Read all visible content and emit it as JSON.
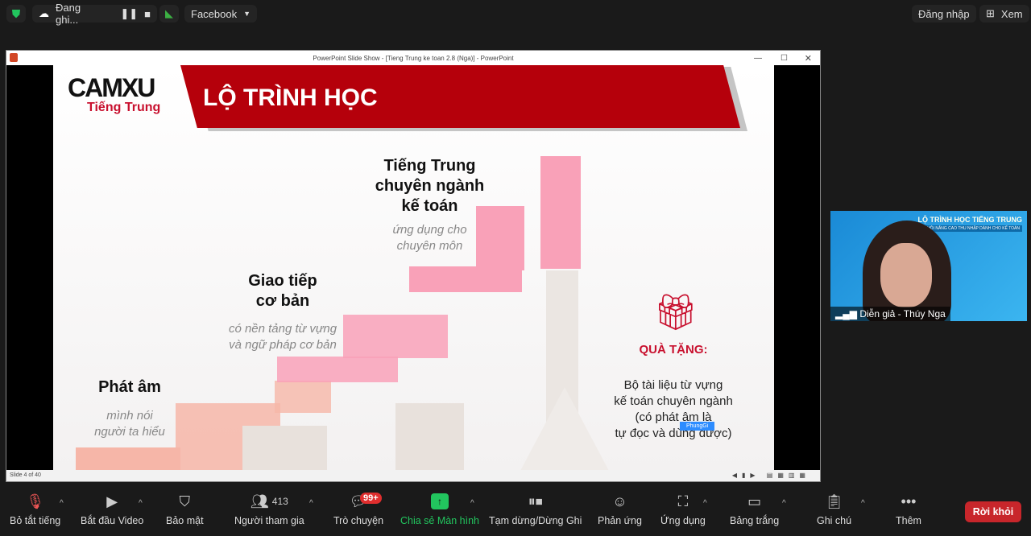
{
  "topbar": {
    "recording": "Đang ghi...",
    "stream": "Facebook",
    "login": "Đăng nhập",
    "view": "Xem"
  },
  "window": {
    "title": "PowerPoint Slide Show - [Tieng Trung ke toan 2.8 (Nga)] - PowerPoint",
    "status": "Slide 4 of 40"
  },
  "slide": {
    "logo_top": "CAMXU",
    "logo_bottom": "Tiếng Trung",
    "title": "LỘ TRÌNH HỌC",
    "steps": [
      {
        "title": "Phát âm",
        "desc": "mình nói\nngười ta hiểu"
      },
      {
        "title": "Giao tiếp\ncơ bản",
        "desc": "có nền tảng từ vựng\nvà ngữ pháp cơ bản"
      },
      {
        "title": "Tiếng Trung\nchuyên ngành\nkế toán",
        "desc": "ứng dụng cho\nchuyên môn"
      }
    ],
    "gift_title": "QUÀ TẶNG:",
    "gift_desc": "Bộ tài liệu từ vựng\nkế toán chuyên ngành\n(có phát âm là\ntự đọc và dùng được)",
    "cursor_label": "PhungGi"
  },
  "video": {
    "name": "Diễn giả - Thúy Nga",
    "banner": "LỘ TRÌNH HỌC TIẾNG TRUNG",
    "banner_sub": "CƠ HỘI NÂNG CAO THU NHẬP DÀNH CHO KẾ TOÁN"
  },
  "toolbar": {
    "mute": "Bỏ tắt tiếng",
    "video": "Bắt đầu Video",
    "security": "Bảo mật",
    "participants": "Người tham gia",
    "participants_count": "413",
    "chat": "Trò chuyện",
    "chat_badge": "99+",
    "share": "Chia sẻ Màn hình",
    "record": "Tạm dừng/Dừng Ghi",
    "reactions": "Phản ứng",
    "apps": "Ứng dụng",
    "whiteboard": "Bảng trắng",
    "notes": "Ghi chú",
    "more": "Thêm",
    "leave": "Rời khỏi"
  },
  "colors": {
    "brand_red": "#b5000b",
    "share_green": "#22c55e",
    "leave": "#c8262b",
    "pink": "#f9a1b8"
  }
}
